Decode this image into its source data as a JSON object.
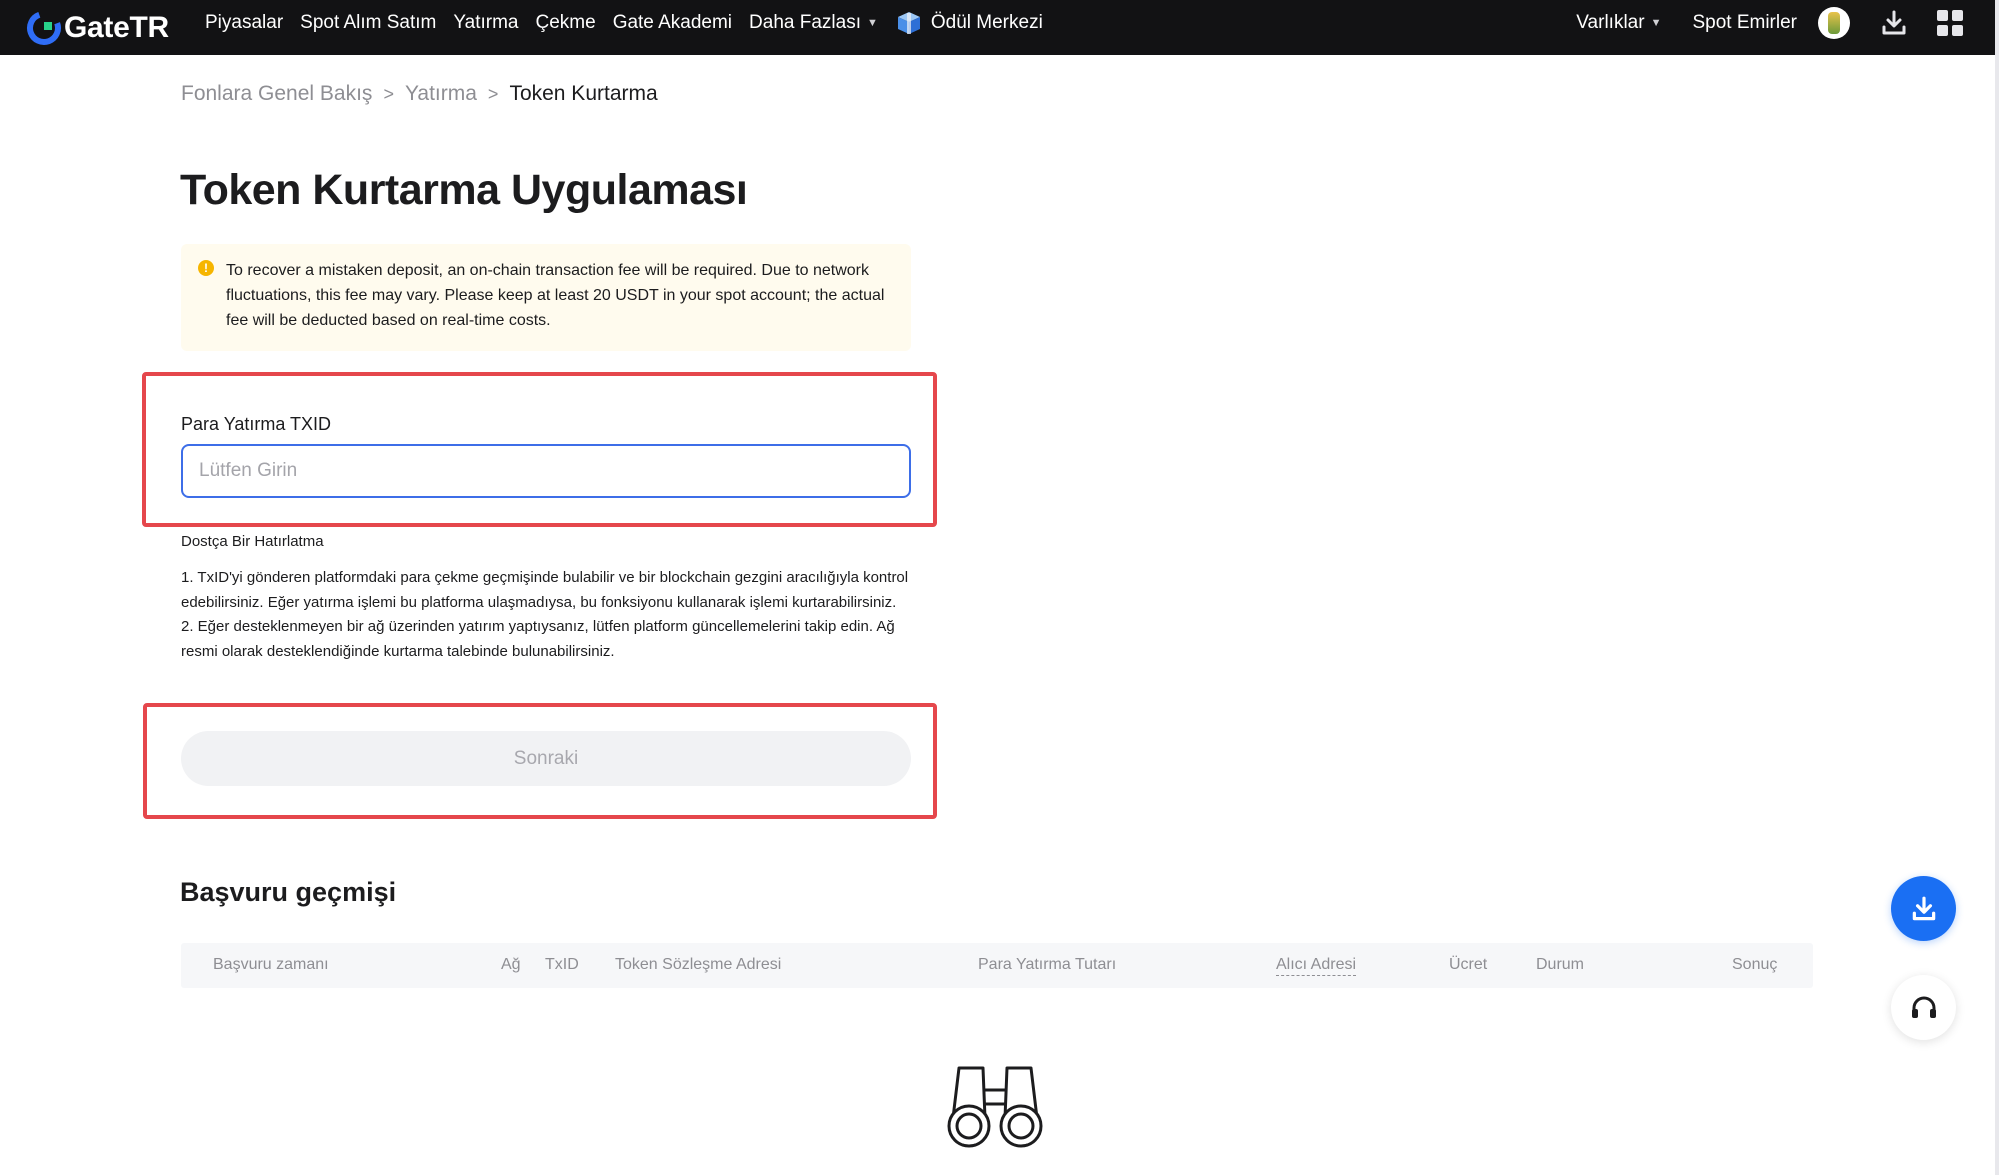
{
  "header": {
    "logo_text": "GateTR",
    "nav": {
      "markets": "Piyasalar",
      "spot_trading": "Spot Alım Satım",
      "deposit": "Yatırma",
      "withdraw": "Çekme",
      "academy": "Gate Akademi",
      "more": "Daha Fazlası",
      "reward_center": "Ödül Merkezi"
    },
    "right": {
      "assets": "Varlıklar",
      "spot_orders": "Spot Emirler"
    }
  },
  "breadcrumb": {
    "items": [
      "Fonlara Genel Bakış",
      "Yatırma",
      "Token Kurtarma"
    ]
  },
  "page": {
    "title": "Token Kurtarma Uygulaması",
    "notice": "To recover a mistaken deposit, an on-chain transaction fee will be required. Due to network fluctuations, this fee may vary. Please keep at least 20 USDT in your spot account; the actual fee will be deducted based on real-time costs."
  },
  "form": {
    "txid_label": "Para Yatırma TXID",
    "txid_value": "",
    "txid_placeholder": "Lütfen Girin",
    "reminder_title": "Dostça Bir Hatırlatma",
    "reminder_1": "1. TxID'yi gönderen platformdaki para çekme geçmişinde bulabilir ve bir blockchain gezgini aracılığıyla kontrol edebilirsiniz. Eğer yatırma işlemi bu platforma ulaşmadıysa, bu fonksiyonu kullanarak işlemi kurtarabilirsiniz.",
    "reminder_2": "2. Eğer desteklenmeyen bir ağ üzerinden yatırım yaptıysanız, lütfen platform güncellemelerini takip edin. Ağ resmi olarak desteklendiğinde kurtarma talebinde bulunabilirsiniz.",
    "next_button": "Sonraki"
  },
  "history": {
    "title": "Başvuru geçmişi",
    "columns": {
      "time": "Başvuru zamanı",
      "network": "Ağ",
      "txid": "TxID",
      "contract": "Token Sözleşme Adresi",
      "amount": "Para Yatırma Tutarı",
      "recipient": "Alıcı Adresi",
      "fee": "Ücret",
      "status": "Durum",
      "result": "Sonuç"
    }
  },
  "colors": {
    "topbar_bg": "#121214",
    "accent_blue": "#1a6ff3",
    "highlight_red": "#e5474c",
    "notice_bg": "#fffbee",
    "warning_yellow": "#f6b500"
  },
  "icons": {
    "logo": "gate-logo-icon",
    "reward": "gift-box-icon",
    "download": "download-icon",
    "apps": "grid-icon",
    "support": "headset-icon",
    "empty": "binoculars-icon",
    "warning": "warning-icon"
  }
}
